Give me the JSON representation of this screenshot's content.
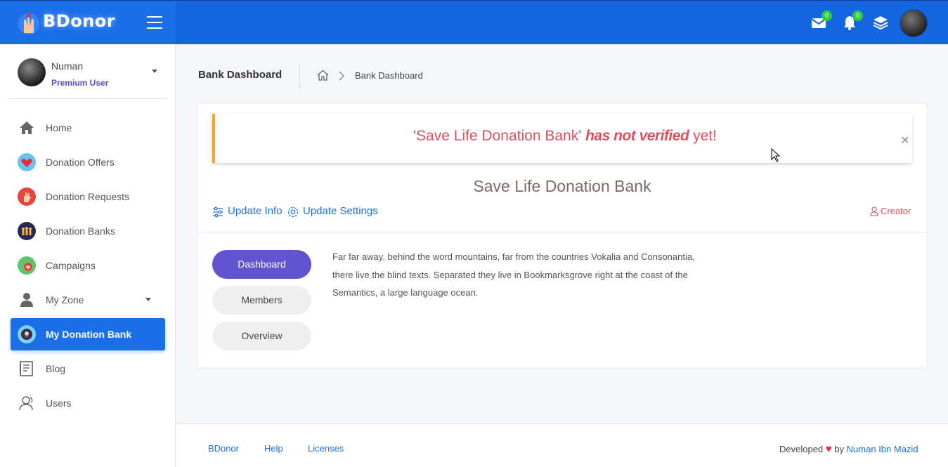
{
  "brand": {
    "name": "BDonor"
  },
  "topbar": {
    "messages_count": "0",
    "notifications_count": "0"
  },
  "user": {
    "name": "Numan",
    "role": "Premium User"
  },
  "sidebar": {
    "items": [
      {
        "label": "Home",
        "icon": "home-icon"
      },
      {
        "label": "Donation Offers",
        "icon": "heart-icon"
      },
      {
        "label": "Donation Requests",
        "icon": "hand-icon"
      },
      {
        "label": "Donation Banks",
        "icon": "people-icon"
      },
      {
        "label": "Campaigns",
        "icon": "campaign-icon"
      },
      {
        "label": "My Zone",
        "icon": "user-icon"
      },
      {
        "label": "My Donation Bank",
        "icon": "bank-icon"
      },
      {
        "label": "Blog",
        "icon": "blog-icon"
      },
      {
        "label": "Users",
        "icon": "users-icon"
      }
    ]
  },
  "header": {
    "title": "Bank Dashboard",
    "breadcrumb_current": "Bank Dashboard"
  },
  "alert": {
    "prefix": "'Save Life Donation Bank'",
    "emphasis": "has not verified",
    "suffix": "yet!",
    "close": "×"
  },
  "bank": {
    "name": "Save Life Donation Bank",
    "update_info": "Update Info",
    "update_settings": "Update Settings",
    "creator": "Creator"
  },
  "tabs": [
    {
      "label": "Dashboard"
    },
    {
      "label": "Members"
    },
    {
      "label": "Overview"
    }
  ],
  "description": "Far far away, behind the word mountains, far from the countries Vokalia and Consonantia, there live the blind texts. Separated they live in Bookmarksgrove right at the coast of the Semantics, a large language ocean.",
  "footer": {
    "links": [
      "BDonor",
      "Help",
      "Licenses"
    ],
    "developed": "Developed",
    "by": "by",
    "developer": "Numan Ibn Mazid"
  },
  "colors": {
    "primary": "#1565e0",
    "active_tab": "#6254cf",
    "alert_text": "#e0505a",
    "alert_border": "#f6a623"
  }
}
